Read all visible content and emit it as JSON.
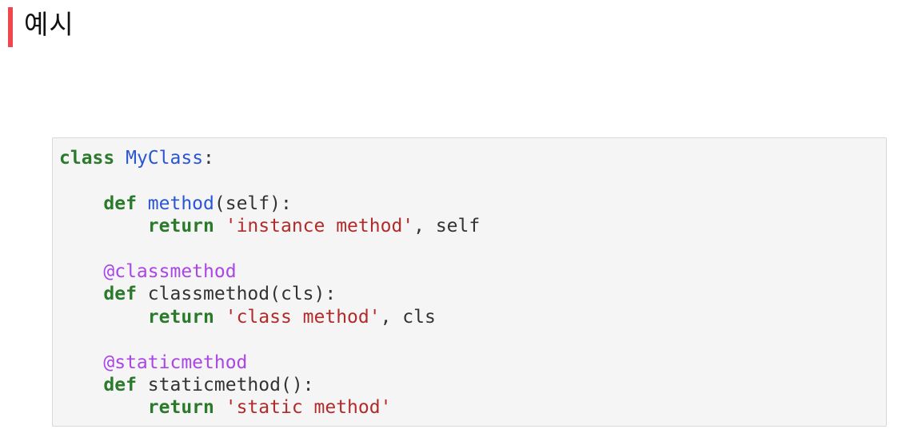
{
  "heading": {
    "title": "예시",
    "accent_color": "#f0474f"
  },
  "code": {
    "lines": [
      [
        {
          "text": "class",
          "kind": "keyword"
        },
        {
          "text": " ",
          "kind": "plain"
        },
        {
          "text": "MyClass",
          "kind": "class-name"
        },
        {
          "text": ":",
          "kind": "plain"
        }
      ],
      [],
      [
        {
          "text": "    ",
          "kind": "plain"
        },
        {
          "text": "def",
          "kind": "keyword"
        },
        {
          "text": " ",
          "kind": "plain"
        },
        {
          "text": "method",
          "kind": "function-name"
        },
        {
          "text": "(self):",
          "kind": "plain"
        }
      ],
      [
        {
          "text": "        ",
          "kind": "plain"
        },
        {
          "text": "return",
          "kind": "keyword"
        },
        {
          "text": " ",
          "kind": "plain"
        },
        {
          "text": "'instance method'",
          "kind": "string"
        },
        {
          "text": ", self",
          "kind": "plain"
        }
      ],
      [],
      [
        {
          "text": "    ",
          "kind": "plain"
        },
        {
          "text": "@classmethod",
          "kind": "decorator"
        }
      ],
      [
        {
          "text": "    ",
          "kind": "plain"
        },
        {
          "text": "def",
          "kind": "keyword"
        },
        {
          "text": " ",
          "kind": "plain"
        },
        {
          "text": "classmethod",
          "kind": "plain"
        },
        {
          "text": "(cls):",
          "kind": "plain"
        }
      ],
      [
        {
          "text": "        ",
          "kind": "plain"
        },
        {
          "text": "return",
          "kind": "keyword"
        },
        {
          "text": " ",
          "kind": "plain"
        },
        {
          "text": "'class method'",
          "kind": "string"
        },
        {
          "text": ", cls",
          "kind": "plain"
        }
      ],
      [],
      [
        {
          "text": "    ",
          "kind": "plain"
        },
        {
          "text": "@staticmethod",
          "kind": "decorator"
        }
      ],
      [
        {
          "text": "    ",
          "kind": "plain"
        },
        {
          "text": "def",
          "kind": "keyword"
        },
        {
          "text": " ",
          "kind": "plain"
        },
        {
          "text": "staticmethod",
          "kind": "plain"
        },
        {
          "text": "():",
          "kind": "plain"
        }
      ],
      [
        {
          "text": "        ",
          "kind": "plain"
        },
        {
          "text": "return",
          "kind": "keyword"
        },
        {
          "text": " ",
          "kind": "plain"
        },
        {
          "text": "'static method'",
          "kind": "string"
        }
      ]
    ]
  },
  "colors": {
    "keyword": "#2b7a2b",
    "class_name": "#2a56d6",
    "function_name": "#2a56d6",
    "string": "#b22b2b",
    "decorator": "#aa45e6",
    "plain": "#333333",
    "code_background": "#f5f5f5"
  }
}
